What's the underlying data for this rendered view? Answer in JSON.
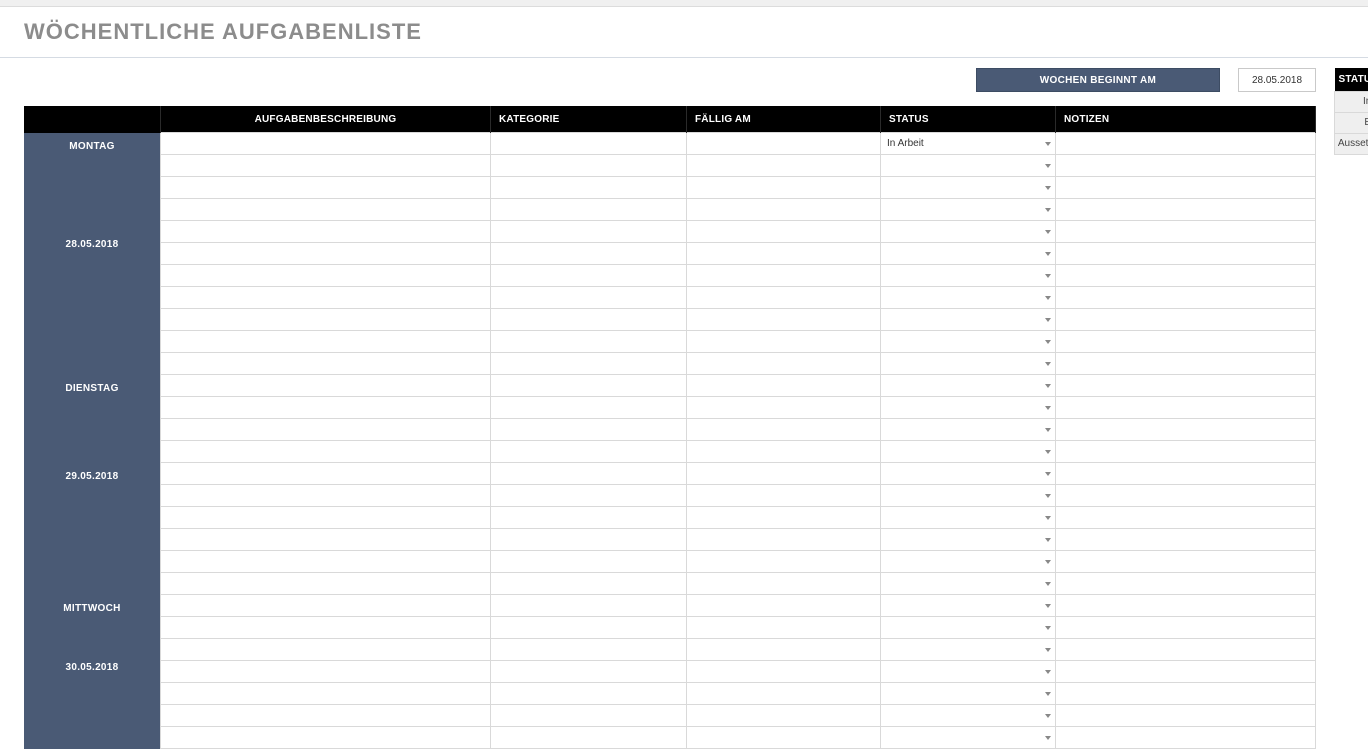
{
  "title": "WÖCHENTLICHE AUFGABENLISTE",
  "top": {
    "week_start_label": "WOCHEN BEGINNT AM",
    "week_start_date": "28.05.2018"
  },
  "columns": {
    "day": "",
    "desc": "AUFGABENBESCHREIBUNG",
    "category": "KATEGORIE",
    "due": "FÄLLIG AM",
    "status": "STATUS",
    "notes": "NOTIZEN"
  },
  "days": [
    {
      "name": "MONTAG",
      "date": "28.05.2018",
      "row_count": 11,
      "rows": [
        {
          "status": "In Arbeit"
        },
        {},
        {},
        {},
        {},
        {},
        {},
        {},
        {},
        {},
        {}
      ]
    },
    {
      "name": "DIENSTAG",
      "date": "29.05.2018",
      "row_count": 10,
      "rows": [
        {},
        {},
        {},
        {},
        {},
        {},
        {},
        {},
        {},
        {}
      ]
    },
    {
      "name": "MITTWOCH",
      "date": "30.05.2018",
      "row_count": 7,
      "rows": [
        {},
        {},
        {},
        {},
        {},
        {},
        {}
      ]
    }
  ],
  "status_panel": {
    "header": "STATUSANZEIGE",
    "options": [
      "In Arbeit",
      "Erledigt",
      "Aussetzen / Warten"
    ]
  }
}
